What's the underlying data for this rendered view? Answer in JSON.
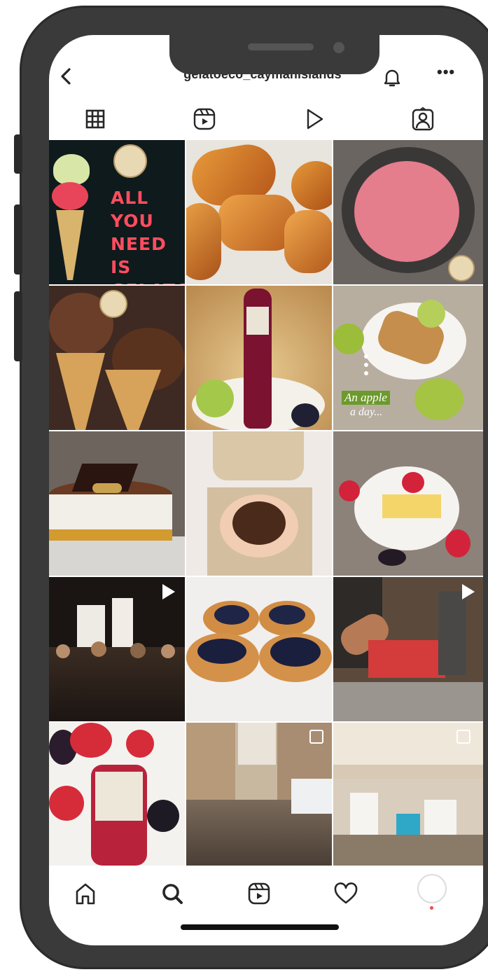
{
  "profile": {
    "username": "gelatoeco_caymanislands"
  },
  "icons": {
    "back": "chevron-left-icon",
    "notifications": "bell-icon",
    "more": "ellipsis-icon",
    "more_glyph": "•••"
  },
  "tabs": [
    {
      "name": "grid",
      "icon": "grid-icon",
      "active": true
    },
    {
      "name": "reels",
      "icon": "reels-icon",
      "active": false
    },
    {
      "name": "videos",
      "icon": "play-icon",
      "active": false
    },
    {
      "name": "tagged",
      "icon": "tagged-user-icon",
      "active": false
    }
  ],
  "posts": [
    {
      "alt": "All you need is gelato poster",
      "overlay_text": "ALL YOU NEED IS GELATO.",
      "badge": "none"
    },
    {
      "alt": "croissants",
      "badge": "none"
    },
    {
      "alt": "pink gelato in machine",
      "badge": "none"
    },
    {
      "alt": "chocolate gelato cones",
      "badge": "none"
    },
    {
      "alt": "Bio Frutta juice bottle",
      "badge": "none"
    },
    {
      "alt": "apple strudel",
      "caption_line1": "An apple",
      "caption_line2": "a day...",
      "badge": "none"
    },
    {
      "alt": "Gelato & Co cake",
      "badge": "none"
    },
    {
      "alt": "coffee beans in hands",
      "badge": "none"
    },
    {
      "alt": "cheesecake slice with berries",
      "badge": "none"
    },
    {
      "alt": "gelato class audience",
      "badge": "reel"
    },
    {
      "alt": "blueberry pastries",
      "badge": "none"
    },
    {
      "alt": "gelato production counter",
      "badge": "reel"
    },
    {
      "alt": "pomegranate juice with berries",
      "badge": "none"
    },
    {
      "alt": "crowded street",
      "badge": "multi"
    },
    {
      "alt": "gelato workshop hall",
      "badge": "multi"
    }
  ],
  "bottom_nav": [
    {
      "name": "home",
      "icon": "home-icon"
    },
    {
      "name": "search",
      "icon": "search-icon"
    },
    {
      "name": "reels",
      "icon": "reels-icon"
    },
    {
      "name": "activity",
      "icon": "heart-icon"
    },
    {
      "name": "profile",
      "icon": "avatar-icon"
    }
  ],
  "colors": {
    "frame": "#3a3a3a",
    "text": "#262626",
    "notification_dot": "#ed4956",
    "poster_text": "#ff4d5e"
  }
}
